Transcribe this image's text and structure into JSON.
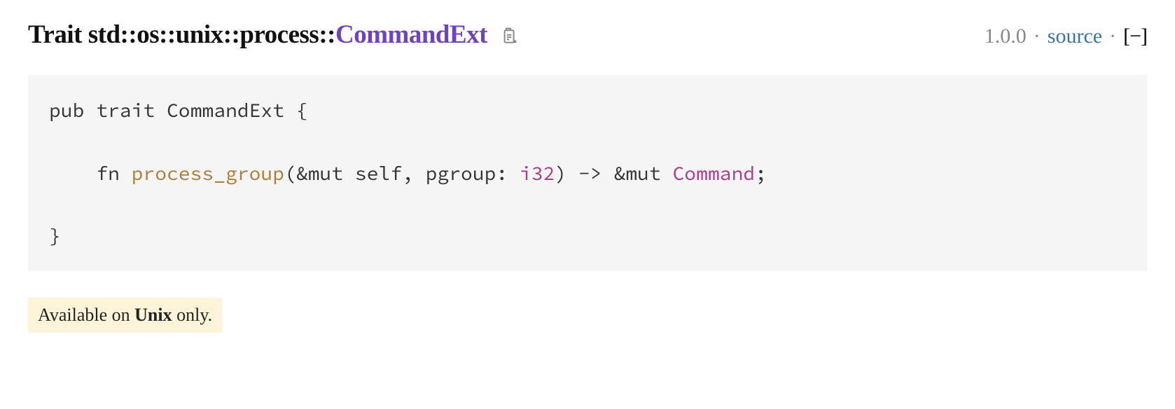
{
  "heading": {
    "kind": "Trait ",
    "path_std": "std",
    "sep": "::",
    "path_os": "os",
    "path_unix": "unix",
    "path_process": "process",
    "type_name": "CommandExt"
  },
  "meta": {
    "version": "1.0.0",
    "source_label": "source",
    "collapse": "[−]"
  },
  "code": {
    "line1": "pub trait CommandExt {",
    "line2": {
      "prefix": "fn ",
      "fn_name": "process_group",
      "after_fn": "(&mut self, pgroup: ",
      "arg_type": "i32",
      "after_arg": ") -> &mut ",
      "ret_type": "Command",
      "suffix": ";"
    },
    "line3": "}"
  },
  "availability": {
    "prefix": "Available on ",
    "platform": "Unix",
    "suffix": " only."
  }
}
